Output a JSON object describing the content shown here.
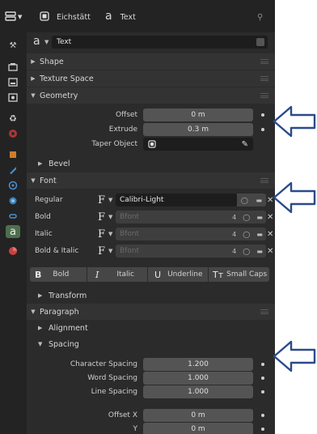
{
  "header": {
    "object_name": "Eichstätt",
    "data_name": "Text",
    "datablock_name": "Text"
  },
  "sections": {
    "shape": "Shape",
    "texture_space": "Texture Space",
    "geometry": "Geometry",
    "bevel": "Bevel",
    "font": "Font",
    "transform": "Transform",
    "paragraph": "Paragraph",
    "alignment": "Alignment",
    "spacing": "Spacing"
  },
  "geometry": {
    "offset_label": "Offset",
    "offset_value": "0 m",
    "extrude_label": "Extrude",
    "extrude_value": "0.3 m",
    "taper_label": "Taper Object"
  },
  "font": {
    "rows": [
      {
        "label": "Regular",
        "font": "Calibri-Light",
        "users": ""
      },
      {
        "label": "Bold",
        "font": "Bfont",
        "users": "4"
      },
      {
        "label": "Italic",
        "font": "Bfont",
        "users": "4"
      },
      {
        "label": "Bold & Italic",
        "font": "Bfont",
        "users": "4"
      }
    ],
    "style_buttons": {
      "bold": "Bold",
      "italic": "Italic",
      "underline": "Underline",
      "small_caps": "Small Caps"
    }
  },
  "spacing": {
    "character_label": "Character Spacing",
    "character_value": "1.200",
    "word_label": "Word Spacing",
    "word_value": "1.000",
    "line_label": "Line Spacing",
    "line_value": "1.000"
  },
  "offset": {
    "x_label": "Offset X",
    "x_value": "0 m",
    "y_label": "Y",
    "y_value": "0 m"
  },
  "icons": [
    "editor-type-icon",
    "text-object-icon",
    "text-data-icon",
    "pin-icon",
    "tool-icon",
    "render-icon",
    "output-icon",
    "view-layer-icon",
    "scene-icon",
    "world-icon",
    "object-icon",
    "modifier-icon",
    "particles-icon",
    "physics-icon",
    "constraints-icon",
    "data-icon",
    "material-icon",
    "arrow-annotation-icon"
  ],
  "colors": {
    "accent_active_tab": "#4d6f4d",
    "annotation_arrow": "#2b4a8c"
  }
}
